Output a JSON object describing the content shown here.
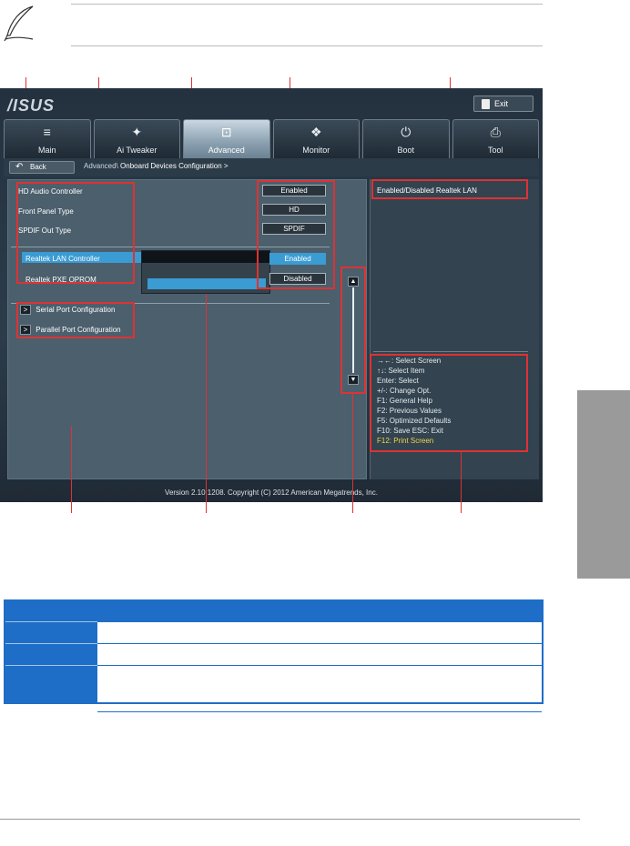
{
  "bios": {
    "logo": "/ISUS",
    "exit_label": "Exit",
    "tabs": [
      {
        "label": "Main",
        "icon": "≡"
      },
      {
        "label": "Ai  Tweaker",
        "icon": "✦"
      },
      {
        "label": "Advanced",
        "icon": "⊡"
      },
      {
        "label": "Monitor",
        "icon": "❖"
      },
      {
        "label": "Boot",
        "icon": "⏻"
      },
      {
        "label": "Tool",
        "icon": "⎙"
      }
    ],
    "back_label": "Back",
    "breadcrumb_prefix": "Advanced\\",
    "breadcrumb_current": "Onboard Devices Configuration  >",
    "items": [
      {
        "label": "HD Audio Controller",
        "value": "Enabled"
      },
      {
        "label": "Front Panel Type",
        "value": "HD"
      },
      {
        "label": "SPDIF Out Type",
        "value": "SPDIF"
      },
      {
        "label": "Realtek LAN Controller",
        "value": "Enabled"
      },
      {
        "label": "Realtek PXE OPROM",
        "value": "Disabled"
      }
    ],
    "submenus": [
      "Serial Port Configuration",
      "Parallel Port Configuration"
    ],
    "help_text": "Enabled/Disabled Realtek LAN",
    "keys": [
      "→←: Select Screen",
      "↑↓: Select Item",
      "Enter: Select",
      "+/-: Change Opt.",
      "F1: General Help",
      "F2: Previous Values",
      "F5: Optimized Defaults",
      "F10: Save   ESC: Exit"
    ],
    "key_highlight": "F12: Print Screen",
    "version": "Version  2.10.1208.  Copyright  (C)  2012  American  Megatrends,  Inc."
  },
  "colors": {
    "accent": "#3b9bd3",
    "callout": "#dd3333",
    "table_blue": "#1e6ec7"
  }
}
